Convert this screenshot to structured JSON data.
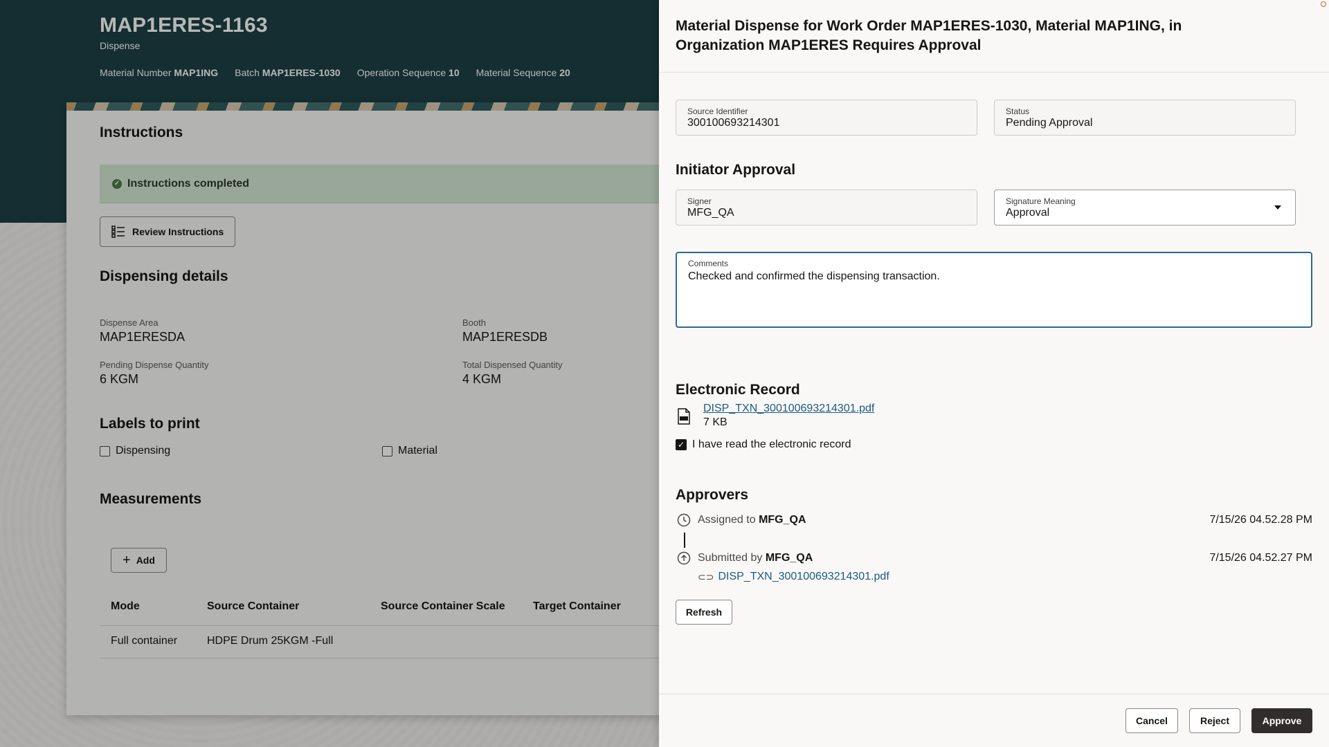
{
  "page": {
    "title": "MAP1ERES-1163",
    "subtitle": "Dispense",
    "meta": [
      {
        "label": "Material Number",
        "value": "MAP1ING"
      },
      {
        "label": "Batch",
        "value": "MAP1ERES-1030"
      },
      {
        "label": "Operation Sequence",
        "value": "10"
      },
      {
        "label": "Material Sequence",
        "value": "20"
      }
    ],
    "instructions": {
      "heading": "Instructions",
      "status": "Instructions completed",
      "review_button": "Review Instructions"
    },
    "dispensing": {
      "heading": "Dispensing details",
      "fields": [
        {
          "label": "Dispense Area",
          "value": "MAP1ERESDA"
        },
        {
          "label": "Booth",
          "value": "MAP1ERESDB"
        },
        {
          "label": "Pending Dispense Quantity",
          "value": "6 KGM"
        },
        {
          "label": "Total Dispensed Quantity",
          "value": "4 KGM"
        }
      ]
    },
    "labels": {
      "heading": "Labels to print",
      "options": [
        "Dispensing",
        "Material"
      ]
    },
    "measurements": {
      "heading": "Measurements",
      "add_button": "Add",
      "columns": [
        "Mode",
        "Source Container",
        "Source Container Scale",
        "Target Container"
      ],
      "rows": [
        [
          "Full container",
          "HDPE Drum 25KGM -Full",
          "",
          ""
        ]
      ]
    }
  },
  "drawer": {
    "title": "Material Dispense for Work Order MAP1ERES-1030, Material MAP1ING, in Organization MAP1ERES Requires Approval",
    "source_identifier": {
      "label": "Source Identifier",
      "value": "300100693214301"
    },
    "status": {
      "label": "Status",
      "value": "Pending Approval"
    },
    "initiator_heading": "Initiator Approval",
    "signer": {
      "label": "Signer",
      "value": "MFG_QA"
    },
    "signature_meaning": {
      "label": "Signature Meaning",
      "value": "Approval"
    },
    "comments": {
      "label": "Comments",
      "value": "Checked and confirmed the dispensing transaction."
    },
    "electronic_record": {
      "heading": "Electronic Record",
      "file_name": "DISP_TXN_300100693214301.pdf",
      "file_size": "7 KB",
      "ack_label": "I have read the electronic record",
      "ack_checked": true
    },
    "approvers": {
      "heading": "Approvers",
      "entries": [
        {
          "action": "Assigned to",
          "user": "MFG_QA",
          "time": "7/15/26 04.52.28 PM"
        },
        {
          "action": "Submitted by",
          "user": "MFG_QA",
          "time": "7/15/26 04.52.27 PM",
          "attachment": "DISP_TXN_300100693214301.pdf"
        }
      ],
      "refresh_button": "Refresh"
    },
    "buttons": {
      "cancel": "Cancel",
      "reject": "Reject",
      "approve": "Approve"
    }
  },
  "colors": {
    "hero": "#1d4045",
    "link": "#1c5a82",
    "focus_border": "#2b6a8c",
    "success_bg": "#d4e8d3",
    "primary_button": "#312d2a"
  }
}
